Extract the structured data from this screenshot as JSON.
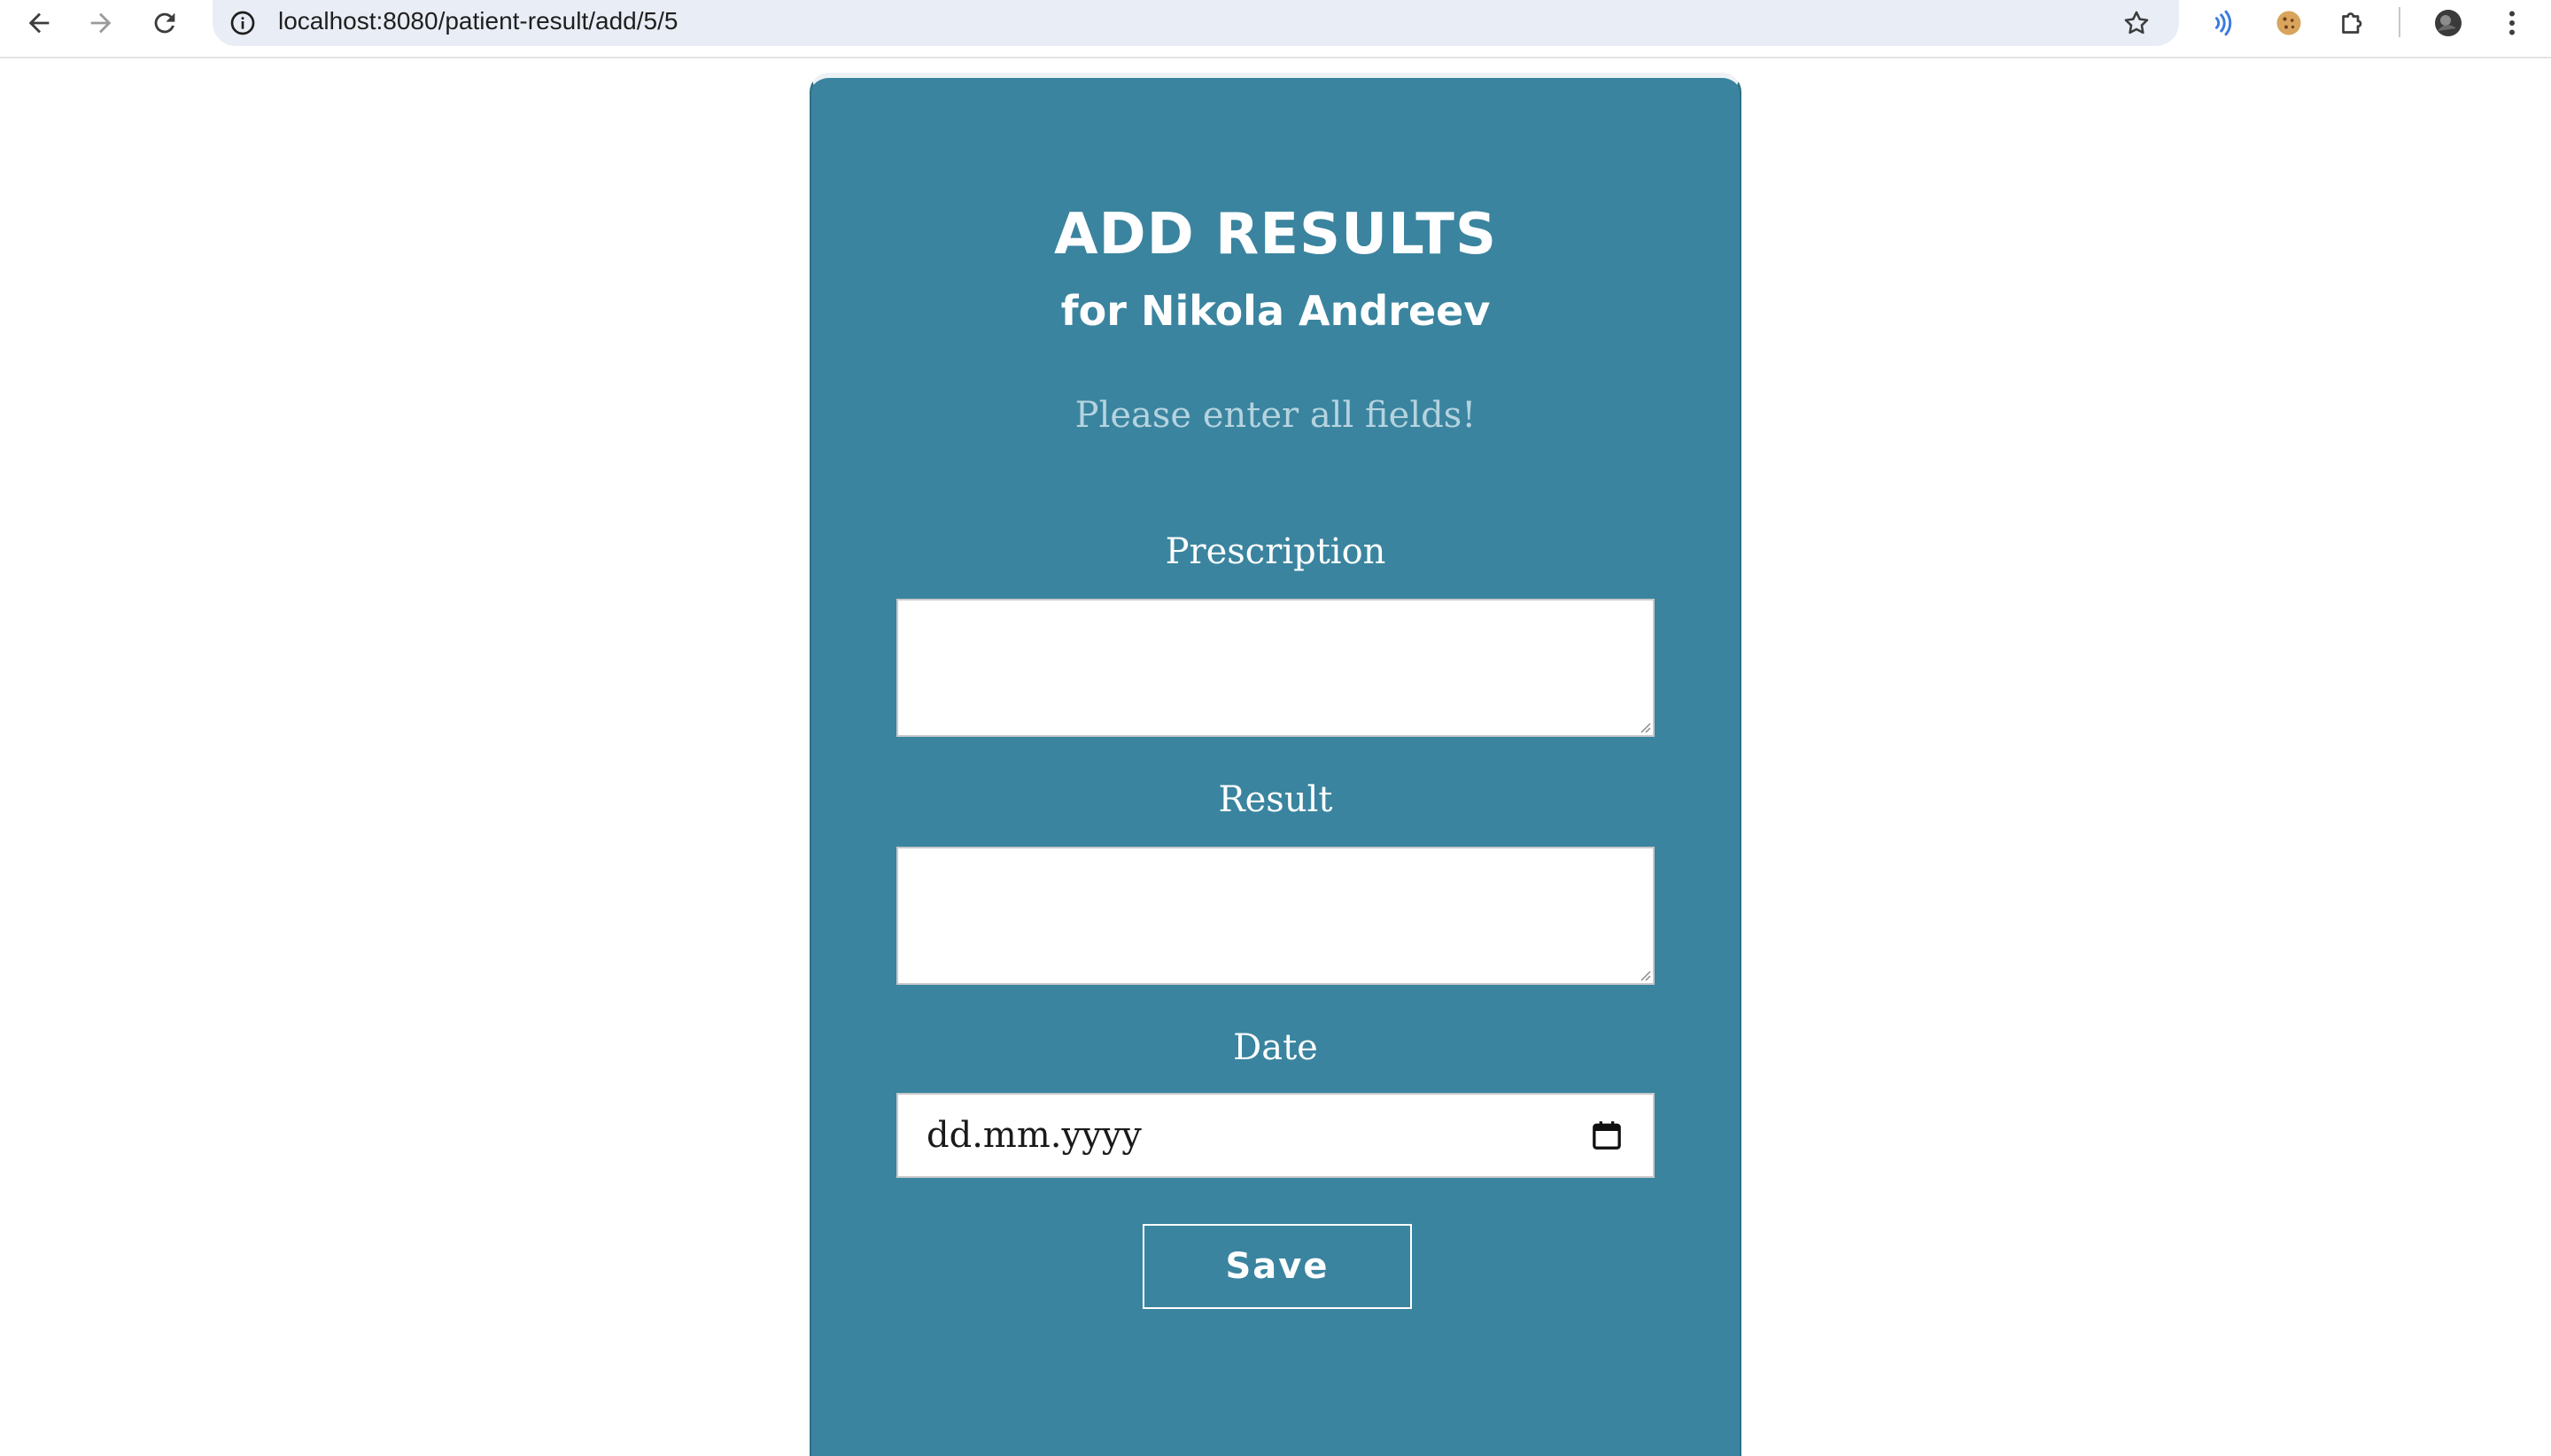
{
  "browser": {
    "url": "localhost:8080/patient-result/add/5/5",
    "icons": {
      "back": "arrow-left-icon",
      "forward": "arrow-right-icon",
      "reload": "reload-icon",
      "site_info": "info-icon",
      "bookmark": "star-icon",
      "extension_1": "sound-wave-icon",
      "extension_2": "cookie-icon",
      "extensions": "puzzle-icon",
      "profile": "avatar-icon",
      "menu": "kebab-menu-icon"
    }
  },
  "form": {
    "title": "ADD RESULTS",
    "subtitle": "for Nikola Andreev",
    "hint": "Please enter all fields!",
    "prescription_label": "Prescription",
    "prescription_value": "",
    "result_label": "Result",
    "result_value": "",
    "date_label": "Date",
    "date_placeholder": "dd.mm.yyyy",
    "save_label": "Save"
  },
  "colors": {
    "card_background": "#3a849f",
    "hint_text": "#b5d3df",
    "text": "#ffffff"
  }
}
